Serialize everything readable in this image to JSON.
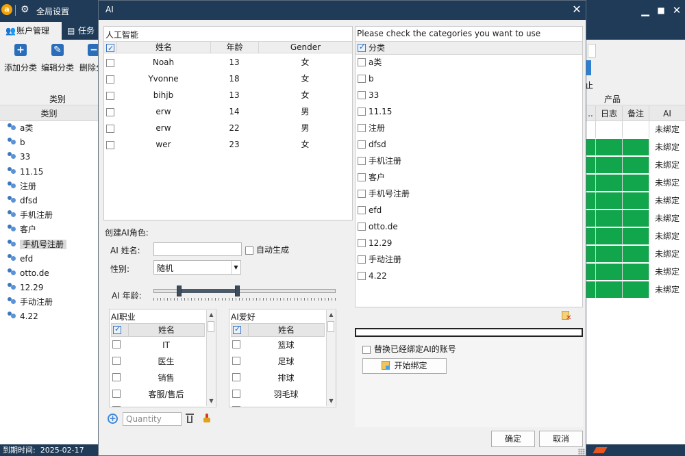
{
  "app": {
    "logo_char": "a",
    "global_settings": "全局设置",
    "tabs": [
      {
        "label": "账户管理",
        "icon": "users-icon"
      },
      {
        "label": "任务",
        "icon": "task-list-icon"
      }
    ],
    "ribbon": {
      "add_category": "添加分类",
      "edit_category": "编辑分类",
      "delete_category": "删除分",
      "group_category": "类别",
      "group_product": "产品",
      "fragment_text": "止"
    },
    "category_header": "类别",
    "categories": [
      "a类",
      "b",
      "33",
      "11.15",
      "注册",
      "dfsd",
      "手机注册",
      "客户",
      "手机号注册",
      "efd",
      "otto.de",
      "12.29",
      "手动注册",
      "4.22"
    ],
    "selected_category_index": 8,
    "right_table": {
      "headers": [
        "..",
        "日志",
        "备注",
        "AI"
      ],
      "rows": [
        {
          "ai": "未绑定",
          "green": false
        },
        {
          "ai": "未绑定",
          "green": true
        },
        {
          "ai": "未绑定",
          "green": true
        },
        {
          "ai": "未绑定",
          "green": true
        },
        {
          "ai": "未绑定",
          "green": true
        },
        {
          "ai": "未绑定",
          "green": true
        },
        {
          "ai": "未绑定",
          "green": true
        },
        {
          "ai": "未绑定",
          "green": true
        },
        {
          "ai": "未绑定",
          "green": true
        },
        {
          "ai": "未绑定",
          "green": true
        }
      ]
    },
    "status": {
      "expiry_label": "到期时间:",
      "expiry_date": "2025-02-17"
    }
  },
  "dialog": {
    "title": "AI",
    "people_panel": {
      "title": "人工智能",
      "headers": {
        "name": "姓名",
        "age": "年龄",
        "gender": "Gender"
      },
      "rows": [
        {
          "name": "Noah",
          "age": "13",
          "gender": "女"
        },
        {
          "name": "Yvonne",
          "age": "18",
          "gender": "女"
        },
        {
          "name": "bihjb",
          "age": "13",
          "gender": "女"
        },
        {
          "name": "erw",
          "age": "14",
          "gender": "男"
        },
        {
          "name": "erw",
          "age": "22",
          "gender": "男"
        },
        {
          "name": "wer",
          "age": "23",
          "gender": "女"
        }
      ]
    },
    "create": {
      "section_label": "创建AI角色:",
      "name_label": "AI 姓名:",
      "name_value": "",
      "auto_generate": "自动生成",
      "gender_label": "性别:",
      "gender_value": "随机",
      "age_label": "AI 年龄:",
      "age_range_fraction": [
        0.14,
        0.46
      ]
    },
    "professions": {
      "title": "AI职业",
      "header": "姓名",
      "items": [
        "IT",
        "医生",
        "销售",
        "客服/售后",
        "..."
      ]
    },
    "hobbies": {
      "title": "AI爱好",
      "header": "姓名",
      "items": [
        "篮球",
        "足球",
        "排球",
        "羽毛球",
        "..."
      ]
    },
    "quantity_placeholder": "Quantity",
    "categories_panel": {
      "title": "Please check the categories you want to use",
      "header": "分类",
      "items": [
        "a类",
        "b",
        "33",
        "11.15",
        "注册",
        "dfsd",
        "手机注册",
        "客户",
        "手机号注册",
        "efd",
        "otto.de",
        "12.29",
        "手动注册",
        "4.22"
      ]
    },
    "progress_fraction": 0,
    "replace_bound": "替换已经绑定AI的账号",
    "start_bind": "开始绑定",
    "ok": "确定",
    "cancel": "取消"
  }
}
